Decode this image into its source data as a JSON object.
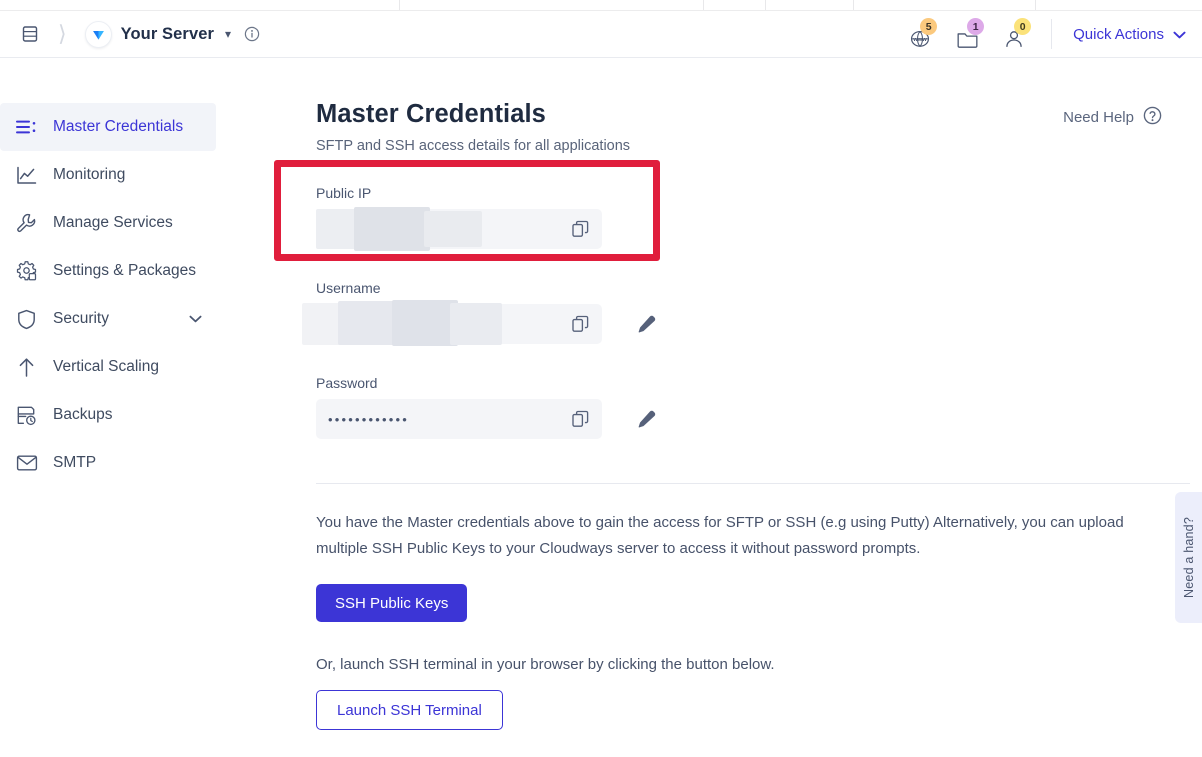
{
  "header": {
    "menu_icon": "hamburger-icon",
    "breadcrumb_separator": "chevron-right-icon",
    "brand_logo": "cloudways-v-logo",
    "brand_name": "Your Server",
    "brand_caret": "chevron-down-icon",
    "info_icon": "info-circle-icon",
    "icons": [
      {
        "name": "www-globe-icon",
        "badge": "5",
        "badge_color": "#fbc97e"
      },
      {
        "name": "folder-icon",
        "badge": "1",
        "badge_color": "#dda9e8"
      },
      {
        "name": "user-icon",
        "badge": "0",
        "badge_color": "#fbe27a"
      }
    ],
    "quick_actions_label": "Quick Actions",
    "quick_actions_caret": "chevron-down-icon",
    "accent_color": "#3c35d6"
  },
  "sidebar": {
    "items": [
      {
        "label": "Master Credentials",
        "icon": "list-credentials-icon",
        "active": true,
        "expandable": false
      },
      {
        "label": "Monitoring",
        "icon": "chart-line-icon",
        "active": false,
        "expandable": false
      },
      {
        "label": "Manage Services",
        "icon": "wrench-icon",
        "active": false,
        "expandable": false
      },
      {
        "label": "Settings & Packages",
        "icon": "gear-packages-icon",
        "active": false,
        "expandable": false
      },
      {
        "label": "Security",
        "icon": "shield-icon",
        "active": false,
        "expandable": true
      },
      {
        "label": "Vertical Scaling",
        "icon": "arrow-up-icon",
        "active": false,
        "expandable": false
      },
      {
        "label": "Backups",
        "icon": "backup-restore-icon",
        "active": false,
        "expandable": false
      },
      {
        "label": "SMTP",
        "icon": "envelope-icon",
        "active": false,
        "expandable": false
      }
    ]
  },
  "main": {
    "title": "Master Credentials",
    "subtitle": "SFTP and SSH access details for all applications",
    "need_help_label": "Need Help",
    "need_help_icon": "question-circle-icon",
    "fields": [
      {
        "label": "Public IP",
        "value": "",
        "redacted": true,
        "copy_icon": "copy-icon",
        "has_edit": false,
        "highlighted": true
      },
      {
        "label": "Username",
        "value": "",
        "redacted": true,
        "copy_icon": "copy-icon",
        "has_edit": true,
        "edit_icon": "pencil-icon",
        "highlighted": false
      },
      {
        "label": "Password",
        "value": "••••••••••••",
        "redacted": false,
        "copy_icon": "copy-icon",
        "has_edit": true,
        "edit_icon": "pencil-icon",
        "highlighted": false
      }
    ],
    "body_text": "You have the Master credentials above to gain the access for SFTP or SSH (e.g using Putty) Alternatively, you can upload multiple SSH Public Keys to your Cloudways server to access it without password prompts.",
    "primary_button_label": "SSH Public Keys",
    "note_text": "Or, launch SSH terminal in your browser by clicking the button below.",
    "outline_button_label": "Launch SSH Terminal",
    "annotation_color": "#e01e3c"
  },
  "side_tab": {
    "label": "Need a hand?"
  }
}
